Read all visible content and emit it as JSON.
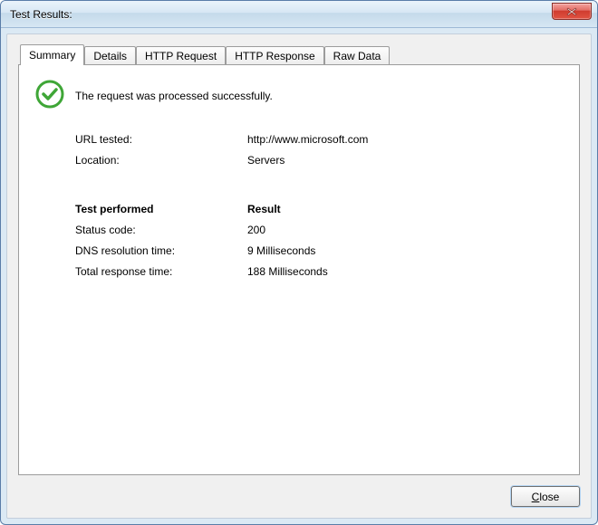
{
  "window": {
    "title": "Test Results:"
  },
  "tabs": {
    "summary": "Summary",
    "details": "Details",
    "http_request": "HTTP Request",
    "http_response": "HTTP Response",
    "raw_data": "Raw Data",
    "active": "summary"
  },
  "status": {
    "icon": "check-circle",
    "message": "The request was processed successfully."
  },
  "info": {
    "url_tested_label": "URL tested:",
    "url_tested_value": "http://www.microsoft.com",
    "location_label": "Location:",
    "location_value": "Servers"
  },
  "results": {
    "section_label": "Test performed",
    "section_result": "Result",
    "status_code_label": "Status code:",
    "status_code_value": "200",
    "dns_time_label": "DNS resolution time:",
    "dns_time_value": "9 Milliseconds",
    "total_time_label": "Total response time:",
    "total_time_value": "188 Milliseconds"
  },
  "footer": {
    "close_label": "Close"
  }
}
